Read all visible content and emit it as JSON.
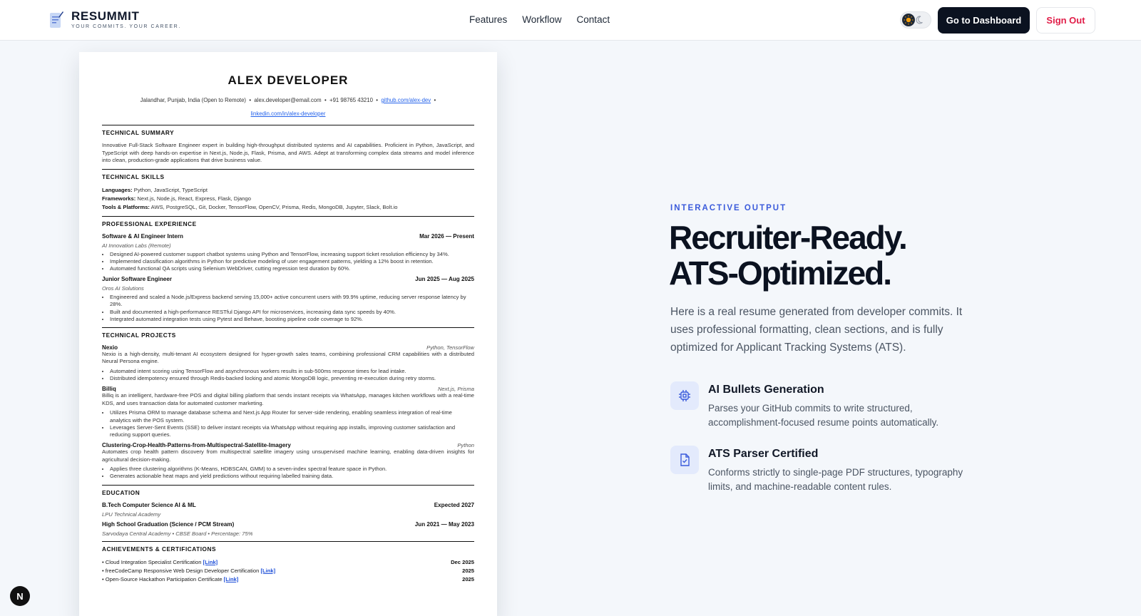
{
  "header": {
    "brand": "RESUMMIT",
    "tagline": "YOUR COMMITS. YOUR CAREER.",
    "nav": [
      "Features",
      "Workflow",
      "Contact"
    ],
    "dashboard_button": "Go to Dashboard",
    "signout_button": "Sign Out"
  },
  "resume": {
    "name": "ALEX DEVELOPER",
    "contact": {
      "location": "Jalandhar, Punjab, India (Open to Remote)",
      "email": "alex.developer@email.com",
      "phone": "+91 98765 43210",
      "github": "github.com/alex-dev",
      "linkedin": "linkedin.com/in/alex-developer",
      "separator": "•"
    },
    "summary_title": "TECHNICAL SUMMARY",
    "summary": "Innovative Full-Stack Software Engineer expert in building high-throughput distributed systems and AI capabilities. Proficient in Python, JavaScript, and TypeScript with deep hands-on expertise in Next.js, Node.js, Flask, Prisma, and AWS. Adept at transforming complex data streams and model inference into clean, production-grade applications that drive business value.",
    "skills_title": "TECHNICAL SKILLS",
    "skills": [
      {
        "label": "Languages:",
        "value": "Python, JavaScript, TypeScript"
      },
      {
        "label": "Frameworks:",
        "value": "Next.js, Node.js, React, Express, Flask, Django"
      },
      {
        "label": "Tools & Platforms:",
        "value": "AWS, PostgreSQL, Git, Docker, TensorFlow, OpenCV, Prisma, Redis, MongoDB, Jupyter, Slack, Bolt.io"
      }
    ],
    "experience_title": "PROFESSIONAL EXPERIENCE",
    "experience": [
      {
        "role": "Software & AI Engineer Intern",
        "dates": "Mar 2026 — Present",
        "company": "AI Innovation Labs (Remote)",
        "bullets": [
          "Designed AI-powered customer support chatbot systems using Python and TensorFlow, increasing support ticket resolution efficiency by 34%.",
          "Implemented classification algorithms in Python for predictive modeling of user engagement patterns, yielding a 12% boost in retention.",
          "Automated functional QA scripts using Selenium WebDriver, cutting regression test duration by 60%."
        ]
      },
      {
        "role": "Junior Software Engineer",
        "dates": "Jun 2025 — Aug 2025",
        "company": "Oros AI Solutions",
        "bullets": [
          "Engineered and scaled a Node.js/Express backend serving 15,000+ active concurrent users with 99.9% uptime, reducing server response latency by 28%.",
          "Built and documented a high-performance RESTful Django API for microservices, increasing data sync speeds by 40%.",
          "Integrated automated integration tests using Pytest and Behave, boosting pipeline code coverage to 92%."
        ]
      }
    ],
    "projects_title": "TECHNICAL PROJECTS",
    "projects": [
      {
        "name": "Nexio",
        "stack": "Python, TensorFlow",
        "desc": "Nexio is a high-density, multi-tenant AI ecosystem designed for hyper-growth sales teams, combining professional CRM capabilities with a distributed Neural Persona engine.",
        "bullets": [
          "Automated intent scoring using TensorFlow and asynchronous workers results in sub-500ms response times for lead intake.",
          "Distributed idempotency ensured through Redis-backed locking and atomic MongoDB logic, preventing re-execution during retry storms."
        ]
      },
      {
        "name": "Billiq",
        "stack": "Next.js, Prisma",
        "desc": "Billiq is an intelligent, hardware-free POS and digital billing platform that sends instant receipts via WhatsApp, manages kitchen workflows with a real-time KDS, and uses transaction data for automated customer marketing.",
        "bullets": [
          "Utilizes Prisma ORM to manage database schema and Next.js App Router for server-side rendering, enabling seamless integration of real-time analytics with the POS system.",
          "Leverages Server-Sent Events (SSE) to deliver instant receipts via WhatsApp without requiring app installs, improving customer satisfaction and reducing support queries."
        ]
      },
      {
        "name": "Clustering-Crop-Health-Patterns-from-Multispectral-Satellite-Imagery",
        "stack": "Python",
        "desc": "Automates crop health pattern discovery from multispectral satellite imagery using unsupervised machine learning, enabling data-driven insights for agricultural decision-making.",
        "bullets": [
          "Applies three clustering algorithms (K-Means, HDBSCAN, GMM) to a seven-index spectral feature space in Python.",
          "Generates actionable heat maps and yield predictions without requiring labelled training data."
        ]
      }
    ],
    "education_title": "EDUCATION",
    "education": [
      {
        "degree": "B.Tech Computer Science AI & ML",
        "dates": "Expected 2027",
        "school": "LPU Technical Academy"
      },
      {
        "degree": "High School Graduation (Science / PCM Stream)",
        "dates": "Jun 2021 — May 2023",
        "school": "Sarvodaya Central Academy • CBSE Board • Percentage: 75%"
      }
    ],
    "achievements_title": "ACHIEVEMENTS & CERTIFICATIONS",
    "achievements": [
      {
        "text": "• Cloud Integration Specialist Certification",
        "link": "[Link]",
        "year": "Dec 2025"
      },
      {
        "text": "• freeCodeCamp Responsive Web Design Developer Certification",
        "link": "[Link]",
        "year": "2025"
      },
      {
        "text": "• Open-Source Hackathon Participation Certificate",
        "link": "[Link]",
        "year": "2025"
      }
    ]
  },
  "hero": {
    "eyebrow": "INTERACTIVE OUTPUT",
    "headline_line1": "Recruiter-Ready.",
    "headline_line2": "ATS-Optimized.",
    "description": "Here is a real resume generated from developer commits. It uses professional formatting, clean sections, and is fully optimized for Applicant Tracking Systems (ATS).",
    "features": [
      {
        "icon": "cpu-chip-icon",
        "title": "AI Bullets Generation",
        "desc": "Parses your GitHub commits to write structured, accomplishment-focused resume points automatically."
      },
      {
        "icon": "file-check-icon",
        "title": "ATS Parser Certified",
        "desc": "Conforms strictly to single-page PDF structures, typography limits, and machine-readable content rules."
      }
    ]
  },
  "dev_badge": "N",
  "colors": {
    "accent": "#3b5bdb",
    "dark": "#0b1220",
    "danger": "#e11d48",
    "icon_bg": "#e3eafc"
  }
}
